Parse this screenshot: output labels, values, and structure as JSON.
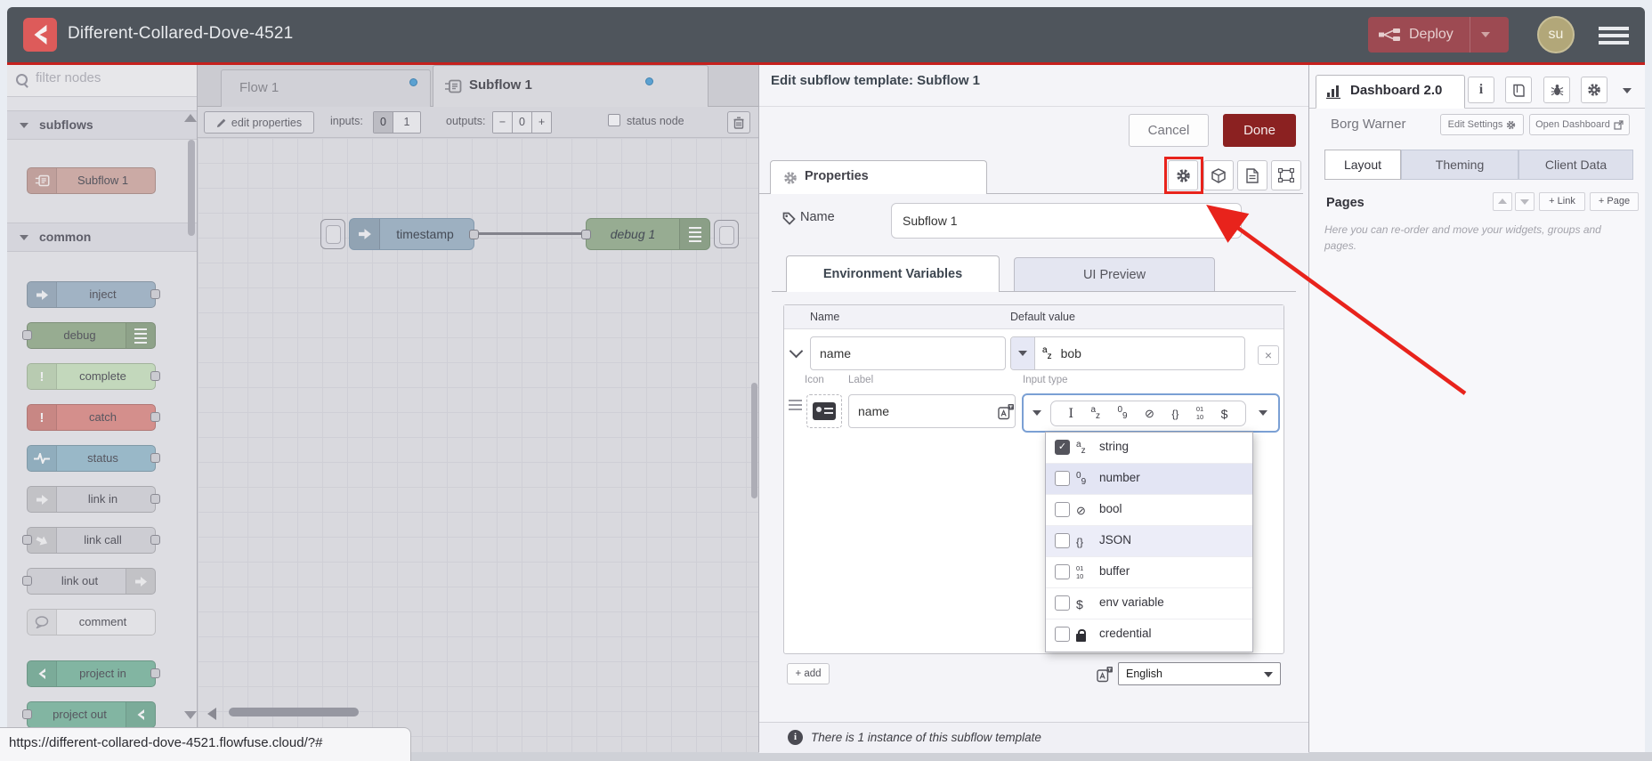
{
  "header": {
    "title": "Different-Collared-Dove-4521",
    "deploy_label": "Deploy",
    "avatar_initials": "su",
    "colors": {
      "bar": "#4f555c",
      "accent_line": "#c5201d",
      "deploy_bg": "#9d4a52",
      "avatar_bg": "#b2a779",
      "logo_bg": "#dd5b5a"
    }
  },
  "palette": {
    "filter_placeholder": "filter nodes",
    "categories": [
      {
        "label": "subflows",
        "nodes": [
          {
            "label": "Subflow 1",
            "color": "#d8b2aa"
          }
        ]
      },
      {
        "label": "common",
        "nodes": [
          {
            "label": "inject",
            "color": "#a8bccd"
          },
          {
            "label": "debug",
            "color": "#9cb493"
          },
          {
            "label": "complete",
            "color": "#cfe6c4"
          },
          {
            "label": "catch",
            "color": "#e2938e"
          },
          {
            "label": "status",
            "color": "#9fc2d2"
          },
          {
            "label": "link in",
            "color": "#dadade"
          },
          {
            "label": "link call",
            "color": "#dadade"
          },
          {
            "label": "link out",
            "color": "#dadade"
          },
          {
            "label": "comment",
            "color": "#f2f2f4"
          },
          {
            "label": "project in",
            "color": "#85bfa7"
          },
          {
            "label": "project out",
            "color": "#85bfa7"
          }
        ]
      }
    ]
  },
  "workspace": {
    "tabs": [
      {
        "label": "Flow 1"
      },
      {
        "label": "Subflow 1"
      }
    ],
    "toolbar": {
      "edit_properties": "edit properties",
      "inputs_label": "inputs:",
      "input_off": "0",
      "input_on": "1",
      "outputs_label": "outputs:",
      "minus": "−",
      "output_count": "0",
      "plus": "+",
      "status_node_label": "status node"
    },
    "nodes": [
      {
        "label": "timestamp"
      },
      {
        "label": "debug 1"
      }
    ]
  },
  "dialog": {
    "title": "Edit subflow template: Subflow 1",
    "cancel_label": "Cancel",
    "done_label": "Done",
    "properties_tab": "Properties",
    "name_label": "Name",
    "name_value": "Subflow 1",
    "tabs": {
      "env": "Environment Variables",
      "ui": "UI Preview"
    },
    "env_table": {
      "name_header": "Name",
      "default_header": "Default value",
      "row": {
        "name": "name",
        "default_value": "bob"
      },
      "detail": {
        "icon_label": "Icon",
        "label_label": "Label",
        "label_value": "name",
        "input_type_label": "Input type"
      }
    },
    "type_options": [
      {
        "label": "string",
        "checked": true
      },
      {
        "label": "number",
        "checked": false
      },
      {
        "label": "bool",
        "checked": false
      },
      {
        "label": "JSON",
        "checked": false
      },
      {
        "label": "buffer",
        "checked": false
      },
      {
        "label": "env variable",
        "checked": false
      },
      {
        "label": "credential",
        "checked": false
      }
    ],
    "add_label": "add",
    "language_value": "English",
    "footer_note": "There is 1 instance of this subflow template",
    "done_color": "#8b2121"
  },
  "sidebar": {
    "dashboard_tab": "Dashboard 2.0",
    "project_label": "Borg Warner",
    "edit_settings_label": "Edit Settings",
    "open_dashboard_label": "Open Dashboard",
    "tabs": [
      "Layout",
      "Theming",
      "Client Data"
    ],
    "pages_label": "Pages",
    "link_button": "+ Link",
    "page_button": "+ Page",
    "help_text": "Here you can re-order and move your widgets, groups and pages."
  },
  "annotation": {
    "color": "#e8231c",
    "target": "subflow-properties-gear-button"
  },
  "status_bar": {
    "url": "https://different-collared-dove-4521.flowfuse.cloud/?#"
  }
}
